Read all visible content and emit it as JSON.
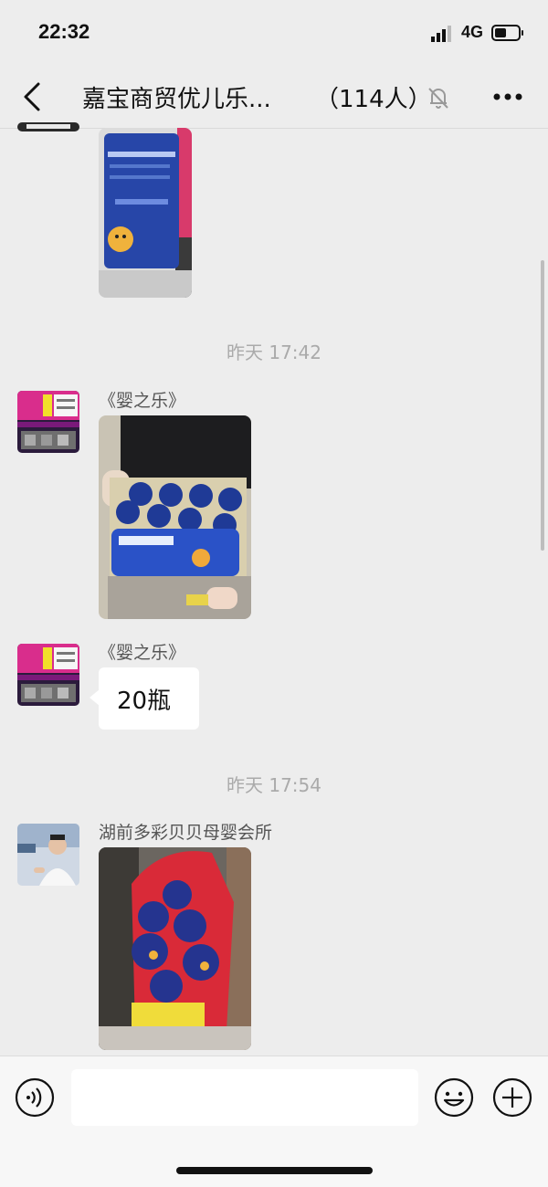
{
  "status_bar": {
    "time": "22:32",
    "network": "4G"
  },
  "header": {
    "title": "嘉宝商贸优儿乐...",
    "member_count": "（114人）"
  },
  "messages": [
    {
      "type": "time",
      "text": "昨天 17:42"
    },
    {
      "type": "image",
      "sender": "《婴之乐》"
    },
    {
      "type": "text",
      "sender": "《婴之乐》",
      "text": "20瓶"
    },
    {
      "type": "time",
      "text": "昨天 17:54"
    },
    {
      "type": "image",
      "sender": "湖前多彩贝贝母婴会所"
    }
  ],
  "icons": [
    "back-icon",
    "mute-bell-icon",
    "more-icon",
    "voice-icon",
    "emoji-icon",
    "plus-icon",
    "signal-icon",
    "battery-icon"
  ]
}
